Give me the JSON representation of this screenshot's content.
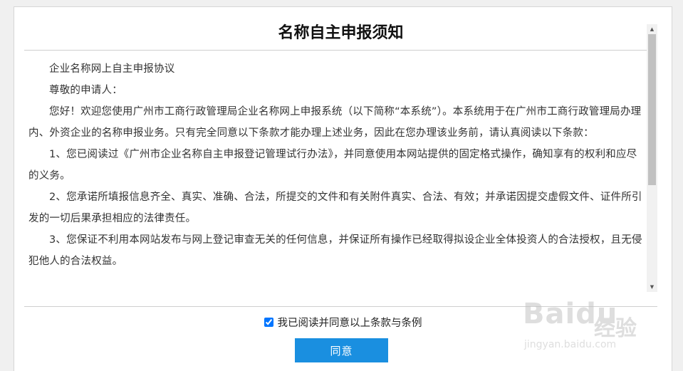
{
  "dialog": {
    "title": "名称自主申报须知",
    "paragraphs": [
      "企业名称网上自主申报协议",
      "尊敬的申请人：",
      "您好！欢迎您使用广州市工商行政管理局企业名称网上申报系统（以下简称“本系统”）。本系统用于在广州市工商行政管理局办理 内、外资企业的名称申报业务。只有完全同意以下条款才能办理上述业务，因此在您办理该业务前，请认真阅读以下条款：",
      "1、您已阅读过《广州市企业名称自主申报登记管理试行办法》，并同意使用本网站提供的固定格式操作，确知享有的权利和应尽的义务。",
      "2、您承诺所填报信息齐全、真实、准确、合法，所提交的文件和有关附件真实、合法、有效；并承诺因提交虚假文件、证件所引发的一切后果承担相应的法律责任。",
      "3、您保证不利用本网站发布与网上登记审查无关的任何信息，并保证所有操作已经取得拟设企业全体投资人的合法授权，且无侵犯他人的合法权益。"
    ],
    "agree_checkbox_label": "我已阅读并同意以上条款与条例",
    "agree_checkbox_checked": true,
    "agree_button_label": "同意",
    "accent_color": "#1a8fe0"
  },
  "watermark": {
    "logo": "Baidu",
    "text": "经验",
    "url": "jingyan.baidu.com"
  }
}
